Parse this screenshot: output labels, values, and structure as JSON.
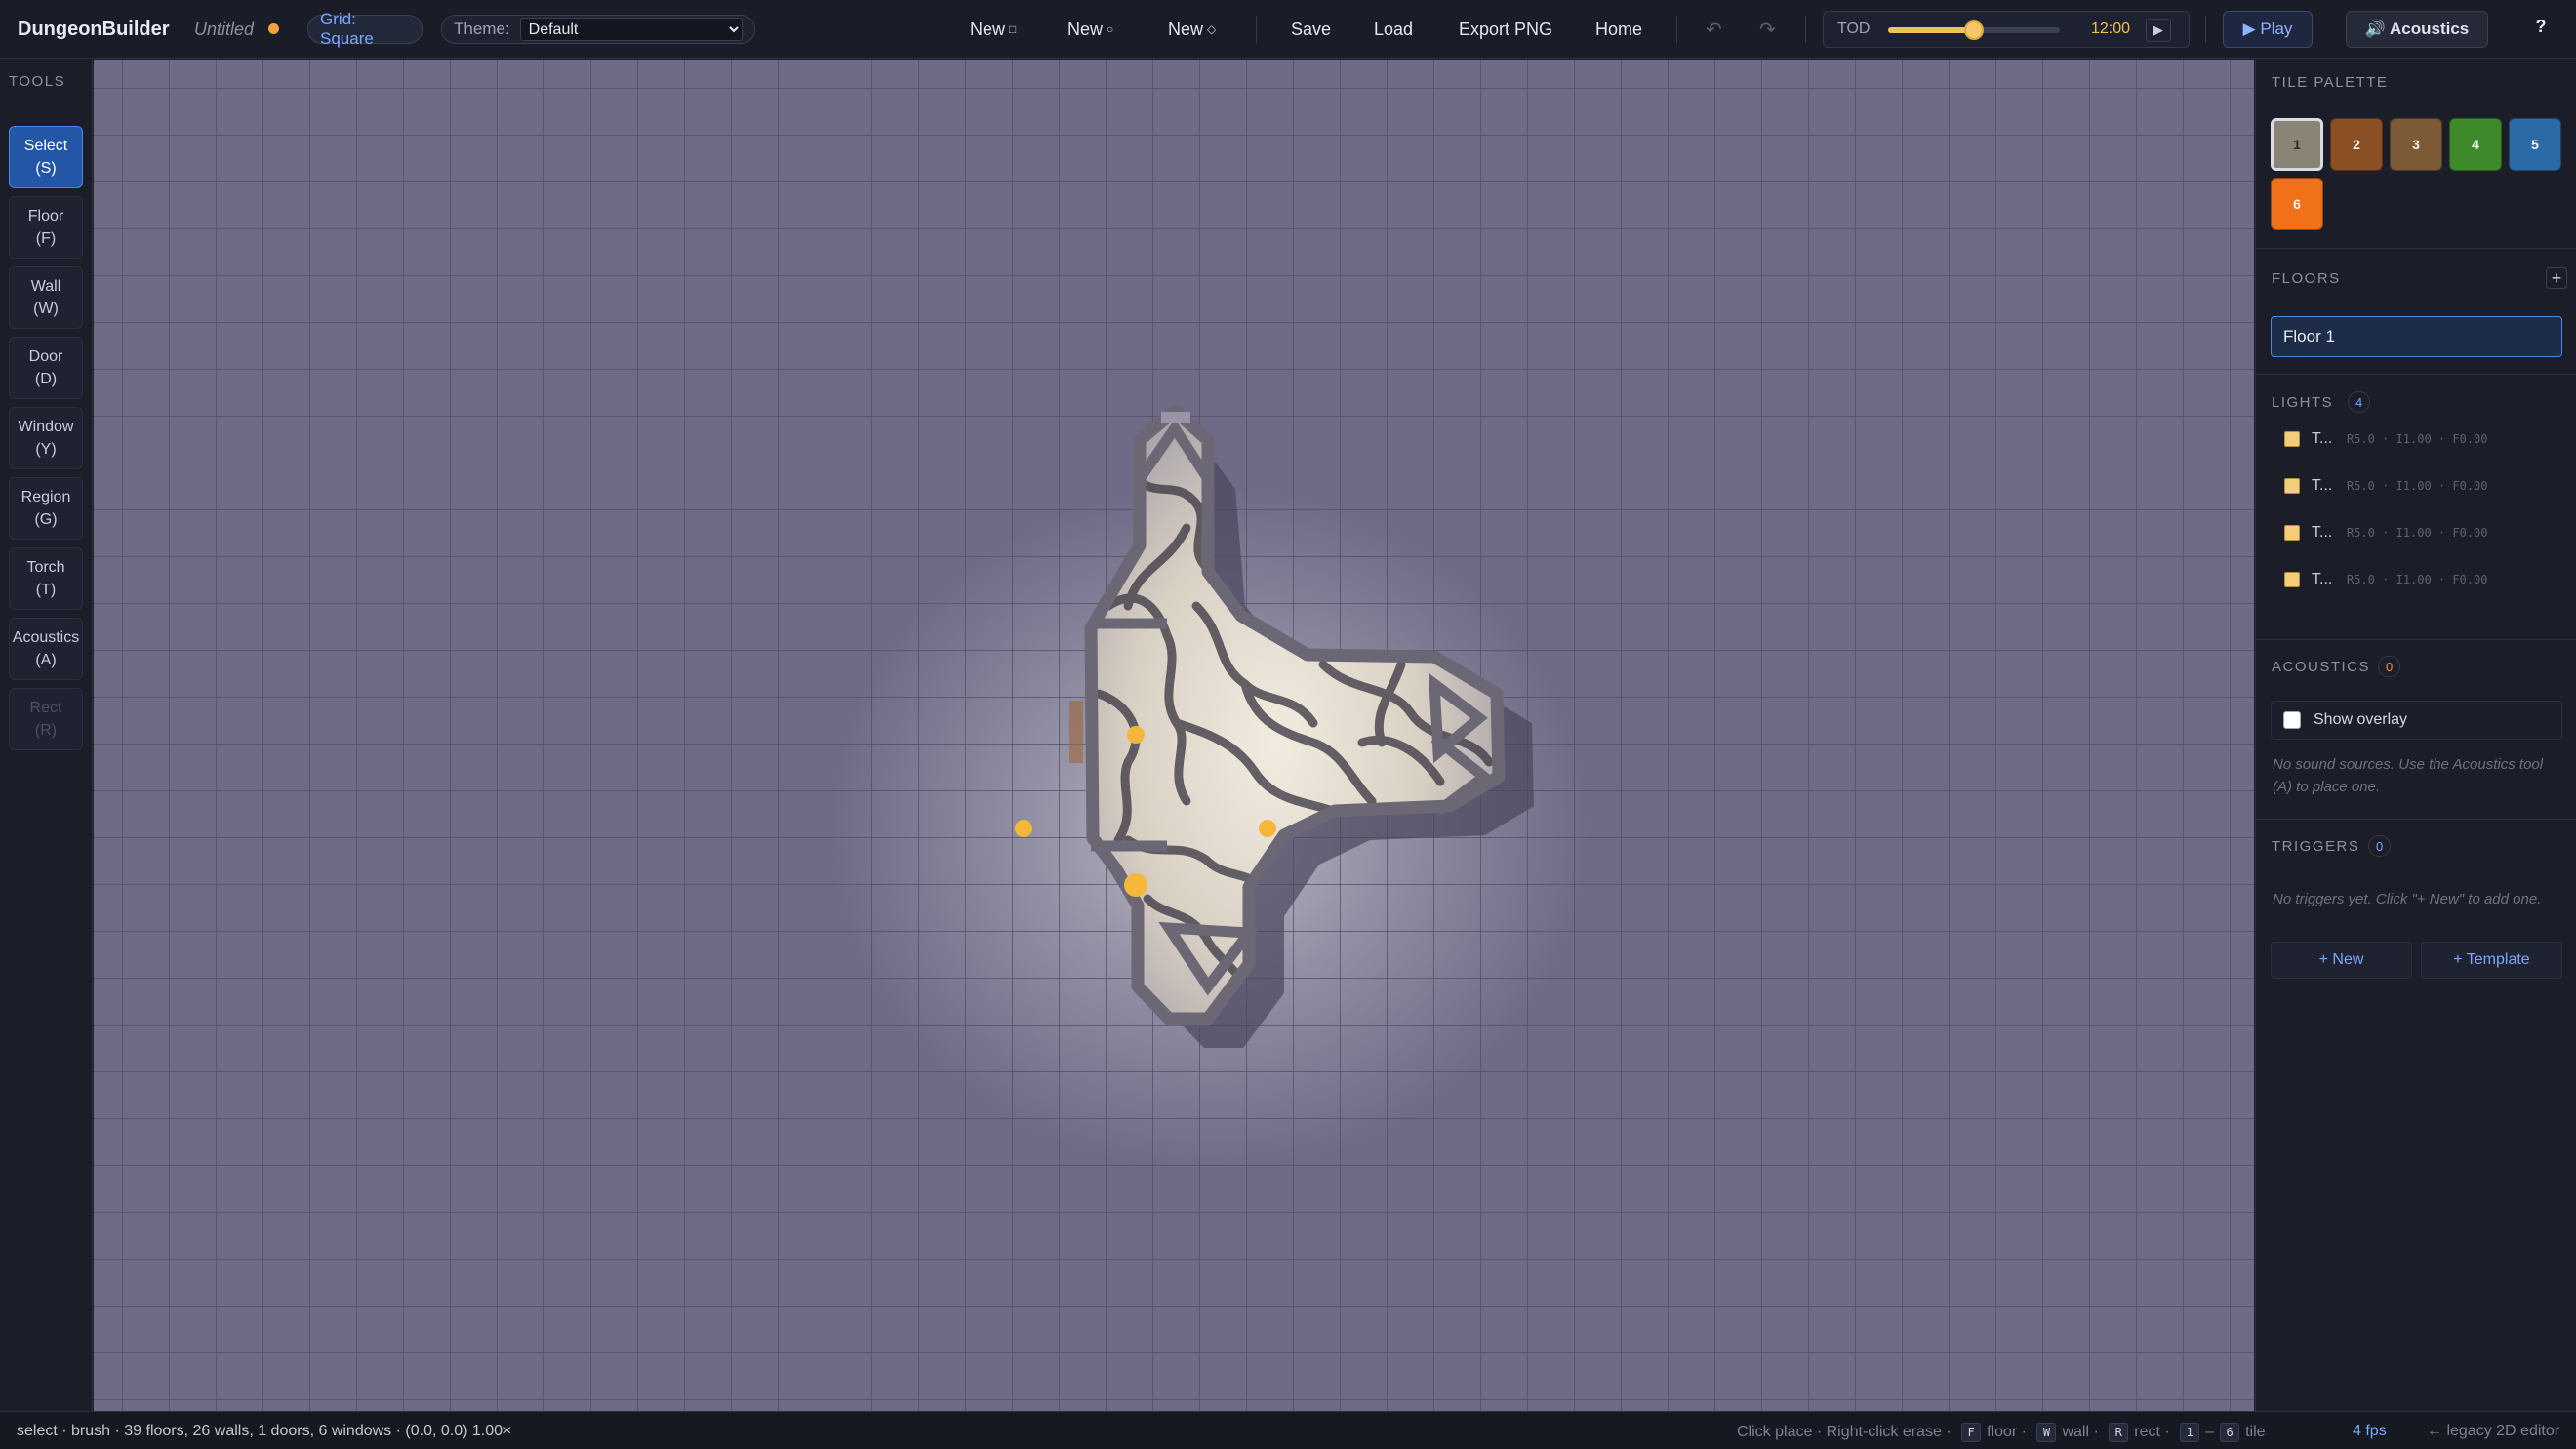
{
  "app": {
    "brand": "DungeonBuilder",
    "doc_name": "Untitled",
    "grid_label": "Grid: Square",
    "theme_label": "Theme:",
    "theme_value": "Default"
  },
  "toolbar": {
    "new_square": "New",
    "new_square_glyph": "□",
    "new_circle": "New",
    "new_circle_glyph": "○",
    "new_diamond": "New",
    "new_diamond_glyph": "◇",
    "save": "Save",
    "load": "Load",
    "export_png": "Export PNG",
    "home": "Home",
    "undo_glyph": "↶",
    "redo_glyph": "↷",
    "tod_label": "TOD",
    "tod_value_fraction": 0.5,
    "tod_time": "12:00",
    "tod_play_glyph": "▶",
    "play": "▶ Play",
    "acoustics": "🔊 Acoustics",
    "help": "?"
  },
  "tools": {
    "label": "TOOLS",
    "items": [
      {
        "label": "Select\n(S)",
        "active": true
      },
      {
        "label": "Floor\n(F)"
      },
      {
        "label": "Wall\n(W)"
      },
      {
        "label": "Door\n(D)"
      },
      {
        "label": "Window\n(Y)"
      },
      {
        "label": "Region\n(G)"
      },
      {
        "label": "Torch\n(T)"
      },
      {
        "label": "Acoustics\n(A)"
      },
      {
        "label": "Rect\n(R)",
        "disabled": true
      }
    ]
  },
  "palette": {
    "label": "TILE PALETTE",
    "tiles": [
      {
        "label": "1",
        "color": "#8a8474",
        "selected": true
      },
      {
        "label": "2",
        "color": "#8a4f22"
      },
      {
        "label": "3",
        "color": "#7c5a35"
      },
      {
        "label": "4",
        "color": "#3e8a2a"
      },
      {
        "label": "5",
        "color": "#2b6aa6"
      },
      {
        "label": "6",
        "color": "#f07118"
      }
    ]
  },
  "floors": {
    "label": "FLOORS",
    "add_glyph": "+",
    "items": [
      "Floor 1"
    ]
  },
  "lights": {
    "label": "LIGHTS",
    "count": "4",
    "items": [
      {
        "name": "T...",
        "meta": "R5.0 · I1.00 · F0.00"
      },
      {
        "name": "T...",
        "meta": "R5.0 · I1.00 · F0.00"
      },
      {
        "name": "T...",
        "meta": "R5.0 · I1.00 · F0.00"
      },
      {
        "name": "T...",
        "meta": "R5.0 · I1.00 · F0.00"
      }
    ]
  },
  "acoustics": {
    "label": "ACOUSTICS",
    "count": "0",
    "overlay_label": "Show overlay",
    "note": "No sound sources. Use the Acoustics tool (A) to place one."
  },
  "triggers": {
    "label": "TRIGGERS",
    "count": "0",
    "note": "No triggers yet. Click \"+ New\" to add one.",
    "new_btn": "+ New",
    "template_btn": "+ Template"
  },
  "status": {
    "left": "select · brush · 39 floors, 26 walls, 1 doors, 6 windows · (0.0, 0.0) 1.00×",
    "hint_click": "Click place",
    "hint_erase": "Right-click erase",
    "key_f": "F",
    "hint_floor": "floor",
    "key_w": "W",
    "hint_wall": "wall",
    "key_r": "R",
    "hint_rect": "rect",
    "key_1": "1",
    "range_sep": "–",
    "key_6": "6",
    "hint_tile": "tile",
    "fps": "4 fps",
    "legacy": "← legacy 2D editor",
    "dot": "·"
  },
  "colors": {
    "accent": "#4d87e6",
    "torch": "#f5b73a",
    "dirty": "#f2a33a"
  }
}
